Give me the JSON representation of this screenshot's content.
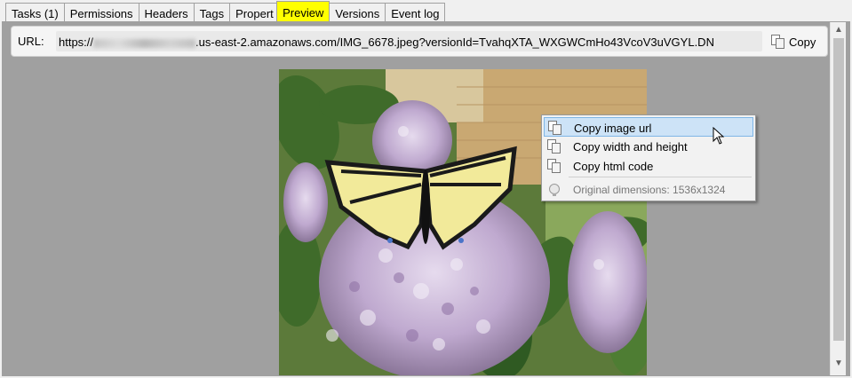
{
  "tabs": [
    {
      "label": "Tasks (1)"
    },
    {
      "label": "Permissions"
    },
    {
      "label": "Headers"
    },
    {
      "label": "Tags"
    },
    {
      "label": "Propert"
    },
    {
      "label": "Preview",
      "active": true
    },
    {
      "label": "Versions"
    },
    {
      "label": "Event log"
    }
  ],
  "url": {
    "label": "URL:",
    "prefix": "https://",
    "value": ".us-east-2.amazonaws.com/IMG_6678.jpeg?versionId=TvahqXTA_WXGWCmHo43VcoV3uVGYL.DN",
    "copy_label": "Copy"
  },
  "context_menu": {
    "items": [
      {
        "label": "Copy image url",
        "highlighted": true
      },
      {
        "label": "Copy width and height"
      },
      {
        "label": "Copy html code"
      }
    ],
    "info": "Original dimensions: 1536x1324"
  },
  "colors": {
    "active_tab": "#ffff00",
    "panel_bg": "#a0a0a0",
    "menu_highlight": "#cde3f7"
  }
}
